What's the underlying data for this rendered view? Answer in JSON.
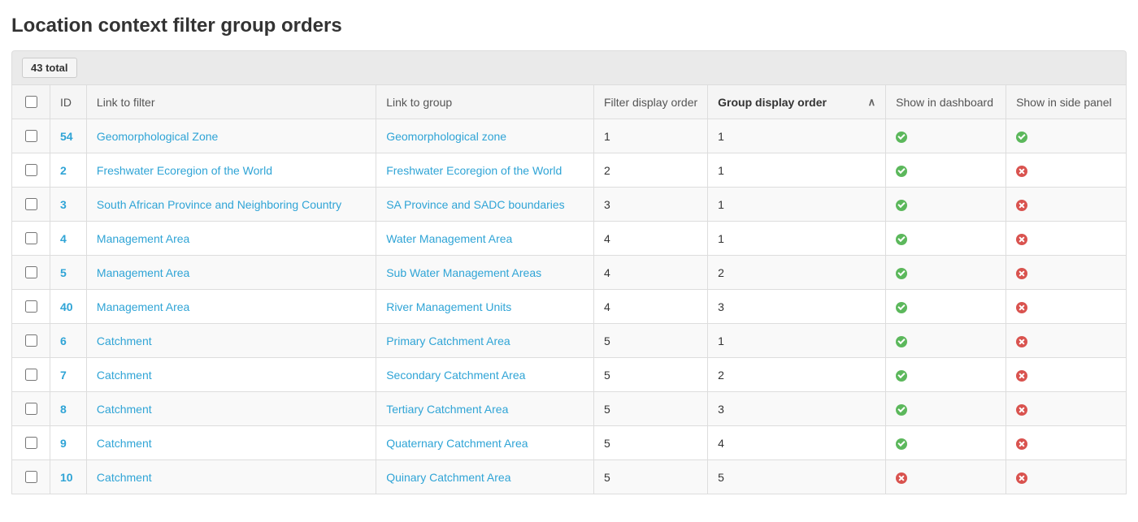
{
  "page": {
    "title": "Location context filter group orders",
    "total_label": "43 total"
  },
  "columns": {
    "id": "ID",
    "filter": "Link to filter",
    "group": "Link to group",
    "filter_display_order": "Filter display order",
    "group_display_order": "Group display order",
    "show_dashboard": "Show in dashboard",
    "show_side_panel": "Show in side panel"
  },
  "sort": {
    "column": "group_display_order",
    "dir": "asc"
  },
  "rows": [
    {
      "id": "54",
      "filter": "Geomorphological Zone",
      "group": "Geomorphological zone",
      "fdo": "1",
      "gdo": "1",
      "dash": true,
      "side": true
    },
    {
      "id": "2",
      "filter": "Freshwater Ecoregion of the World",
      "group": "Freshwater Ecoregion of the World",
      "fdo": "2",
      "gdo": "1",
      "dash": true,
      "side": false
    },
    {
      "id": "3",
      "filter": "South African Province and Neighboring Country",
      "group": "SA Province and SADC boundaries",
      "fdo": "3",
      "gdo": "1",
      "dash": true,
      "side": false
    },
    {
      "id": "4",
      "filter": "Management Area",
      "group": "Water Management Area",
      "fdo": "4",
      "gdo": "1",
      "dash": true,
      "side": false
    },
    {
      "id": "5",
      "filter": "Management Area",
      "group": "Sub Water Management Areas",
      "fdo": "4",
      "gdo": "2",
      "dash": true,
      "side": false
    },
    {
      "id": "40",
      "filter": "Management Area",
      "group": "River Management Units",
      "fdo": "4",
      "gdo": "3",
      "dash": true,
      "side": false
    },
    {
      "id": "6",
      "filter": "Catchment",
      "group": "Primary Catchment Area",
      "fdo": "5",
      "gdo": "1",
      "dash": true,
      "side": false
    },
    {
      "id": "7",
      "filter": "Catchment",
      "group": "Secondary Catchment Area",
      "fdo": "5",
      "gdo": "2",
      "dash": true,
      "side": false
    },
    {
      "id": "8",
      "filter": "Catchment",
      "group": "Tertiary Catchment Area",
      "fdo": "5",
      "gdo": "3",
      "dash": true,
      "side": false
    },
    {
      "id": "9",
      "filter": "Catchment",
      "group": "Quaternary Catchment Area",
      "fdo": "5",
      "gdo": "4",
      "dash": true,
      "side": false
    },
    {
      "id": "10",
      "filter": "Catchment",
      "group": "Quinary Catchment Area",
      "fdo": "5",
      "gdo": "5",
      "dash": false,
      "side": false
    }
  ]
}
